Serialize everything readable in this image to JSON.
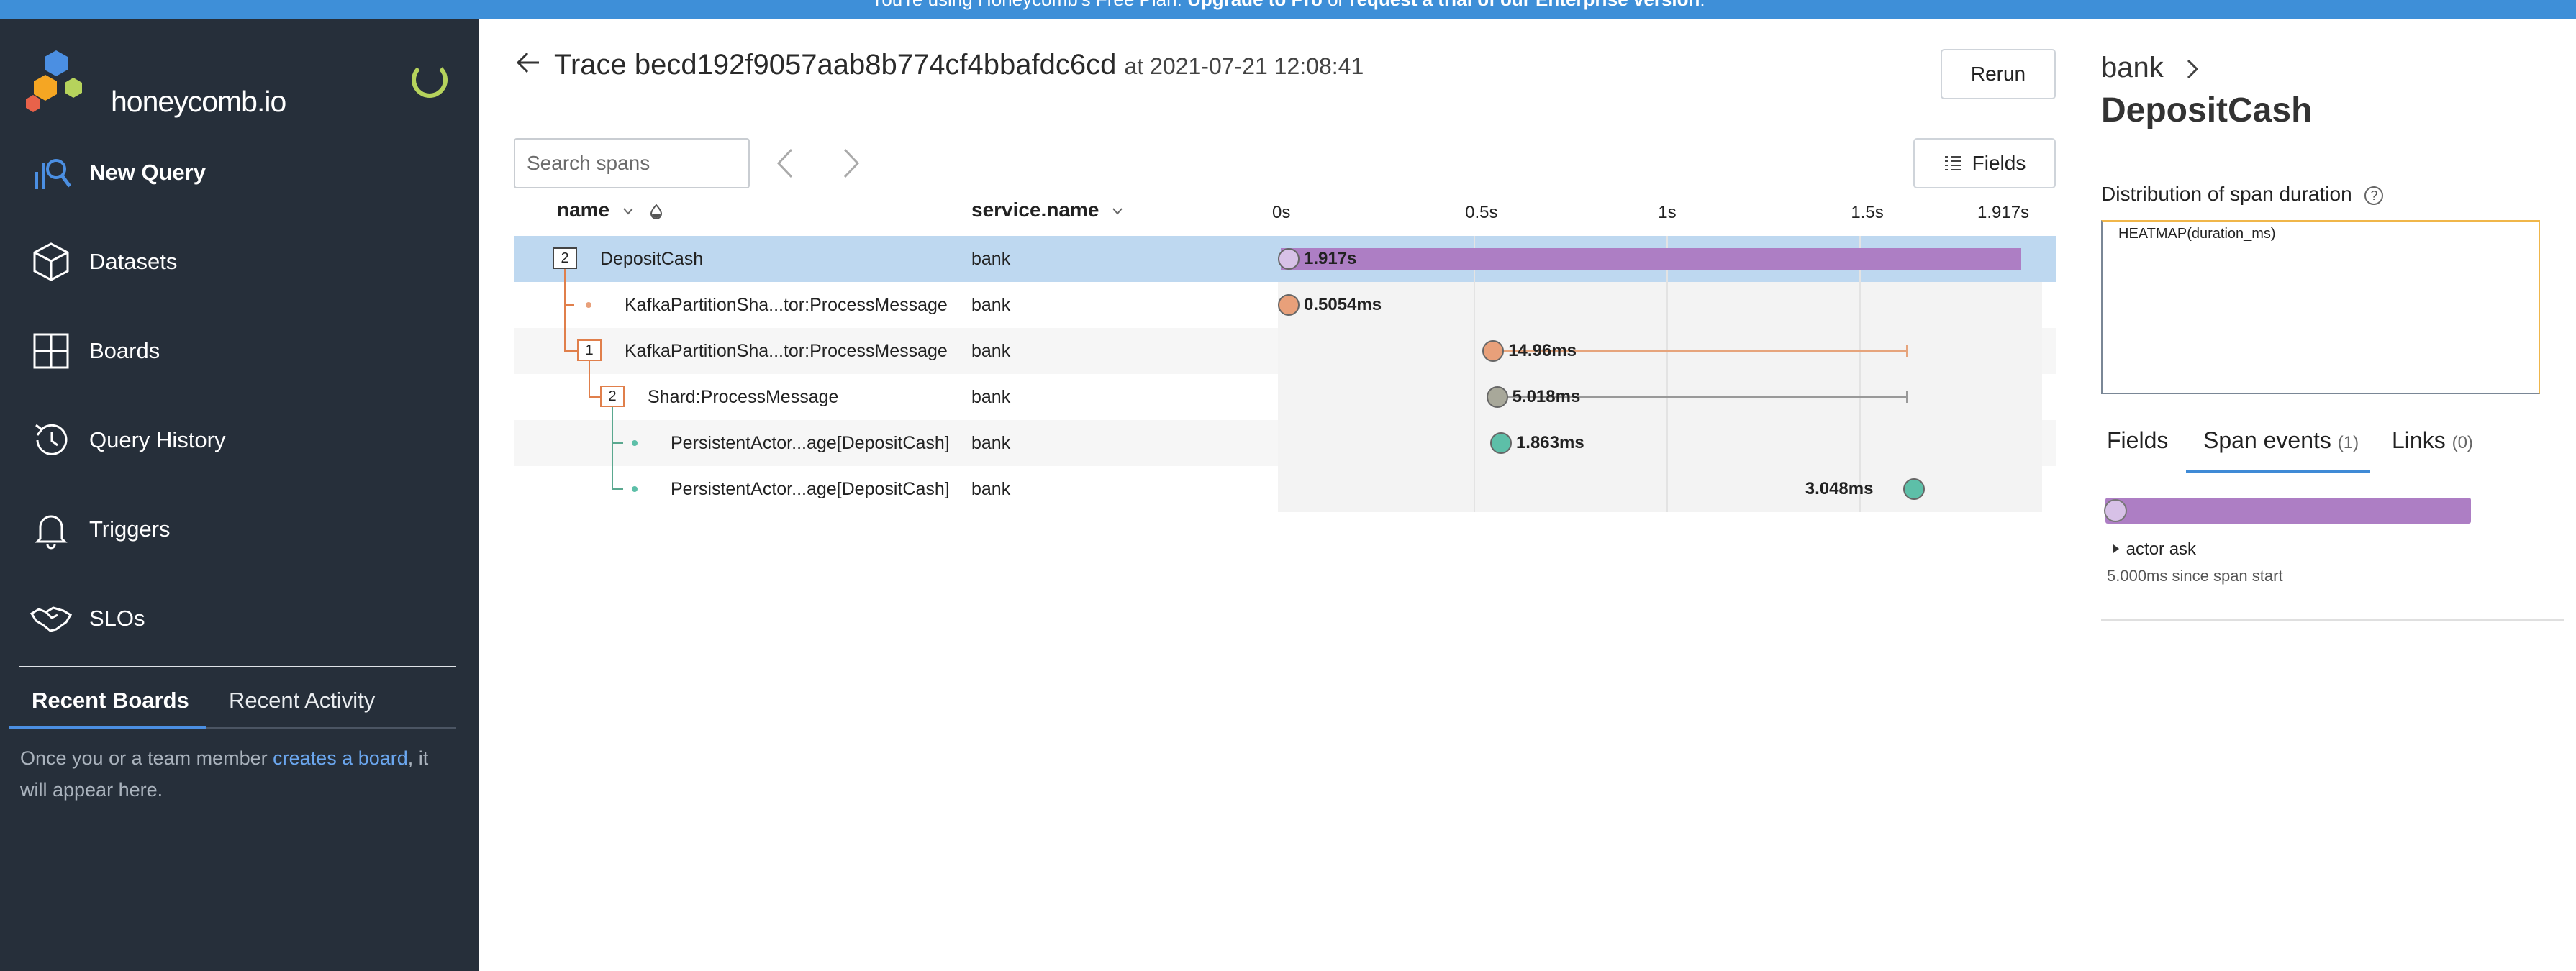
{
  "banner": {
    "prefix": "You're using Honeycomb's Free Plan.",
    "upgrade": "Upgrade to Pro",
    "or": "or",
    "trial": "request a trial of our Enterprise version",
    "suffix": "."
  },
  "sidebar": {
    "logo_text": "honeycomb.io",
    "items": [
      {
        "label": "New Query",
        "icon": "query-icon"
      },
      {
        "label": "Datasets",
        "icon": "cube-icon"
      },
      {
        "label": "Boards",
        "icon": "grid-icon"
      },
      {
        "label": "Query History",
        "icon": "history-icon"
      },
      {
        "label": "Triggers",
        "icon": "bell-icon"
      },
      {
        "label": "SLOs",
        "icon": "handshake-icon"
      }
    ],
    "tabs": {
      "recent_boards": "Recent Boards",
      "recent_activity": "Recent Activity"
    },
    "empty_message": {
      "before": "Once you or a team member ",
      "link": "creates a board",
      "after": ", it will appear here."
    }
  },
  "trace": {
    "title_prefix": "Trace",
    "trace_id": "becd192f9057aab8b774cf4bbafdc6cd",
    "at_label": "at 2021-07-21 12:08:41",
    "rerun_label": "Rerun",
    "search_placeholder": "Search spans",
    "fields_label": "Fields"
  },
  "table": {
    "columns": {
      "name": "name",
      "service": "service.name"
    },
    "ticks": [
      "0s",
      "0.5s",
      "1s",
      "1.5s",
      "1.917s"
    ],
    "rows": [
      {
        "count": "2",
        "name": "DepositCash",
        "service": "bank",
        "duration_label": "1.917s",
        "start": 0,
        "duration_s": 1.917
      },
      {
        "count": "",
        "name": "KafkaPartitionSha...tor:ProcessMessage",
        "service": "bank",
        "duration_label": "0.5054ms",
        "start": 0,
        "duration_s": 0.0005054
      },
      {
        "count": "1",
        "name": "KafkaPartitionSha...tor:ProcessMessage",
        "service": "bank",
        "duration_label": "14.96ms",
        "start": 0.53,
        "duration_s": 0.01496
      },
      {
        "count": "2",
        "name": "Shard:ProcessMessage",
        "service": "bank",
        "duration_label": "5.018ms",
        "start": 0.54,
        "duration_s": 0.005018
      },
      {
        "count": "",
        "name": "PersistentActor...age[DepositCash]",
        "service": "bank",
        "duration_label": "1.863ms",
        "start": 0.55,
        "duration_s": 0.001863
      },
      {
        "count": "",
        "name": "PersistentActor...age[DepositCash]",
        "service": "bank",
        "duration_label": "3.048ms",
        "start": 1.62,
        "duration_s": 0.003048
      }
    ]
  },
  "panel": {
    "service": "bank",
    "span_name": "DepositCash",
    "distribution_label": "Distribution of span duration",
    "heatmap_label": "HEATMAP(duration_ms)",
    "tabs": [
      {
        "label": "Fields",
        "count": ""
      },
      {
        "label": "Span events",
        "count": "(1)"
      },
      {
        "label": "Links",
        "count": "(0)"
      }
    ],
    "event": {
      "name": "actor ask",
      "since": "5.000ms since span start"
    }
  },
  "colors": {
    "accent": "#3e8fd8",
    "sidebar": "#262f3a",
    "root_bar": "#ad7ec4",
    "kafka": "#e8a07a",
    "shard": "#a8a89a",
    "actor": "#5dbfa8"
  }
}
